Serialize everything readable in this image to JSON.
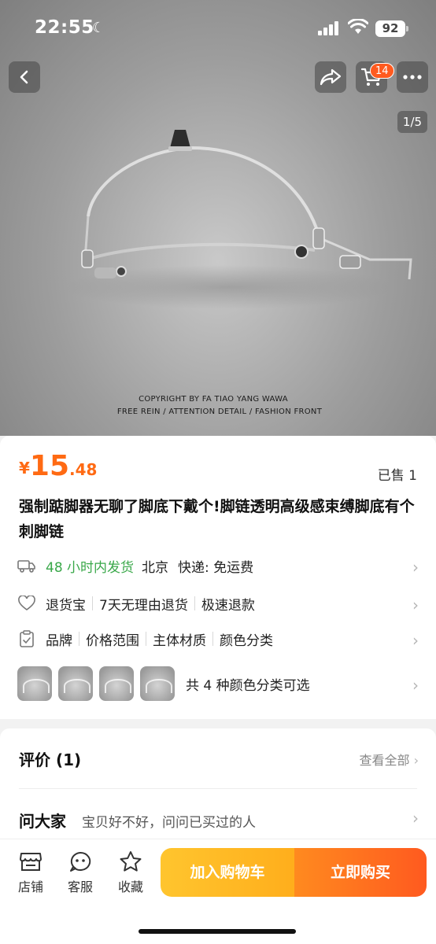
{
  "status_bar": {
    "time": "22:55",
    "battery": "92"
  },
  "header": {
    "cart_count": "14",
    "pager": "1/5"
  },
  "hero": {
    "watermark_line1": "COPYRIGHT  BY  FA TIAO YANG WAWA",
    "watermark_line2": "FREE  REIN  /  ATTENTION  DETAIL  /  FASHION  FRONT"
  },
  "product": {
    "currency": "¥",
    "price_int": "15",
    "price_dec": ".48",
    "sold": "已售 1",
    "title": "强制踮脚器无聊了脚底下戴个!脚链透明高级感束缚脚底有个刺脚链"
  },
  "shipping": {
    "time": "48 小时内发货",
    "origin": "北京",
    "method": "快递: 免运费"
  },
  "services": [
    "退货宝",
    "7天无理由退货",
    "极速退款"
  ],
  "attributes": [
    "品牌",
    "价格范围",
    "主体材质",
    "颜色分类"
  ],
  "variants": {
    "thumbnail_count": 4,
    "label": "共 4 种颜色分类可选"
  },
  "reviews": {
    "title": "评价 (1)",
    "see_all": "查看全部"
  },
  "ask": {
    "title": "问大家",
    "hint": "宝贝好不好，问问已买过的人"
  },
  "bottom_bar": {
    "store": "店铺",
    "service": "客服",
    "favorite": "收藏",
    "add_to_cart": "加入购物车",
    "buy_now": "立即购买"
  },
  "colors": {
    "accent": "#ff6a13",
    "cta_cart": "#ffb820",
    "cta_buy": "#ff6a1f",
    "green": "#3aa84a"
  }
}
